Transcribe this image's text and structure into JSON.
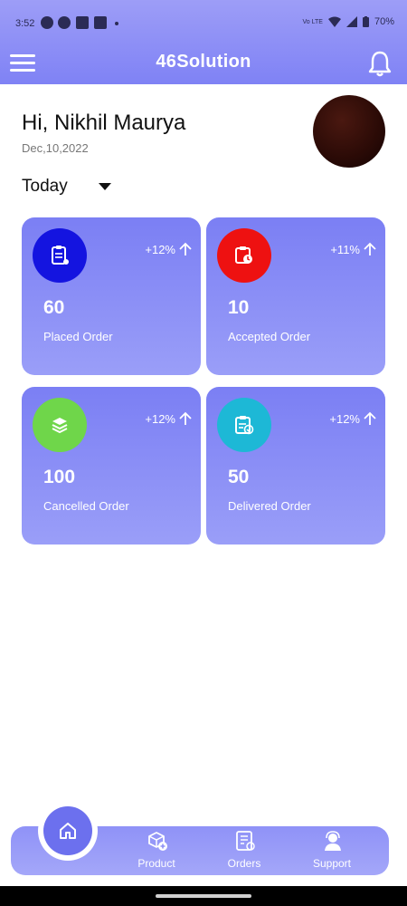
{
  "status_bar": {
    "time": "3:52",
    "network": "Vo LTE",
    "battery": "70%"
  },
  "header": {
    "title": "46Solution",
    "menu_icon": "hamburger-menu-icon",
    "notification_icon": "bell-icon"
  },
  "profile": {
    "greeting": "Hi, Nikhil Maurya",
    "date": "Dec,10,2022"
  },
  "filter": {
    "period": "Today"
  },
  "stats": [
    {
      "count": "60",
      "label": "Placed Order",
      "change": "+12%",
      "icon": "clipboard-icon",
      "icon_bg": "#1414e0"
    },
    {
      "count": "10",
      "label": "Accepted Order",
      "change": "+11%",
      "icon": "clipboard-clock-icon",
      "icon_bg": "#ee1111"
    },
    {
      "count": "100",
      "label": "Cancelled Order",
      "change": "+12%",
      "icon": "layers-icon",
      "icon_bg": "#6fd64a"
    },
    {
      "count": "50",
      "label": "Delivered Order",
      "change": "+12%",
      "icon": "clipboard-check-icon",
      "icon_bg": "#1db8d6"
    }
  ],
  "bottom_nav": {
    "items": [
      {
        "label": "Product",
        "icon": "box-add-icon"
      },
      {
        "label": "Orders",
        "icon": "orders-list-icon"
      },
      {
        "label": "Support",
        "icon": "support-agent-icon"
      }
    ],
    "home_icon": "home-icon"
  },
  "colors": {
    "primary": "#7b7ff4",
    "card_gradient_end": "#9a9ef8"
  }
}
